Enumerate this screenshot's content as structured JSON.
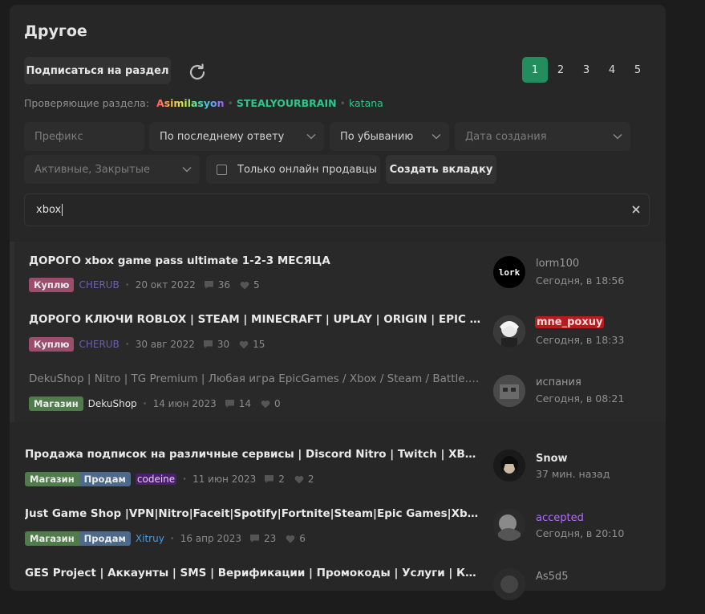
{
  "section": {
    "title": "Другое",
    "subscribe_label": "Подписаться на раздел",
    "pages": [
      "1",
      "2",
      "3",
      "4",
      "5"
    ],
    "reviewers_label": "Проверяющие раздела:",
    "reviewers": [
      "Asimilasyon",
      "STEALYOURBRAIN",
      "katana"
    ]
  },
  "filters": {
    "prefix_placeholder": "Префикс",
    "sort_by": "По последнему ответу",
    "order": "По убыванию",
    "date_placeholder": "Дата создания",
    "status": "Активные, Закрытые",
    "online_sellers": "Только онлайн продавцы",
    "create_tab": "Создать вкладку"
  },
  "search": {
    "value": "xbox"
  },
  "threads": [
    {
      "title": "ДОРОГО xbox game pass ultimate 1-2-3 МЕСЯЦА",
      "tags": [
        "Куплю"
      ],
      "author": "CHERUB",
      "date": "20 окт 2022",
      "replies": "36",
      "likes": "5",
      "last_poster": "lorm100",
      "last_date": "Сегодня, в 18:56"
    },
    {
      "title": "ДОРОГО КЛЮЧИ ROBLOX | STEAM | MINECRAFT | UPLAY | ORIGIN | EPIC | XBOX | BATTLE.NET",
      "tags": [
        "Куплю"
      ],
      "author": "CHERUB",
      "date": "30 авг 2022",
      "replies": "30",
      "likes": "15",
      "last_poster": "mne_poxuy",
      "last_date": "Сегодня, в 18:33"
    },
    {
      "title": "DekuShop | Nitro | TG Premium | Любая игра EpicGames / Xbox / Steam / Battle.net",
      "tags": [
        "Магазин"
      ],
      "author": "DekuShop",
      "date": "14 июн 2023",
      "replies": "14",
      "likes": "0",
      "last_poster": "испания",
      "last_date": "Сегодня, в 08:21"
    },
    {
      "title": "Продажа подписок на различные сервисы | Discord Nitro | Twitch | XBox Game Pass",
      "tags": [
        "Магазин",
        "Продам"
      ],
      "author": "codeine",
      "date": "11 июн 2023",
      "replies": "2",
      "likes": "2",
      "last_poster": "Snow",
      "last_date": "37 мин. назад"
    },
    {
      "title": "Just Game Shop |VPN|Nitro|Faceit|Spotify|Fortnite|Steam|Epic Games|Xbox|Boosting",
      "tags": [
        "Магазин",
        "Продам"
      ],
      "author": "Xitruy",
      "date": "16 апр 2023",
      "replies": "23",
      "likes": "6",
      "last_poster": "accepted",
      "last_date": "Сегодня, в 20:10"
    },
    {
      "title": "GES Project | Аккаунты | SMS | Верификации | Промокоды | Услуги | Казино",
      "tags": [],
      "author": "",
      "date": "",
      "replies": "",
      "likes": "",
      "last_poster": "As5d5",
      "last_date": ""
    }
  ],
  "colors": {
    "accent": "#228e5d",
    "buy_tag": "#9c4d6d",
    "shop_tag": "#4f7c4a",
    "sell_tag": "#4d6a8a",
    "codeine": "#a64dff",
    "cherub": "#6b5fb0",
    "xitruy": "#4d9cd9",
    "accepted": "#b36bff",
    "mne_poxuy_bg": "#b71c1c"
  },
  "icons": [
    "refresh-icon",
    "chevron-down-icon",
    "clear-icon",
    "comment-icon",
    "heart-icon"
  ]
}
